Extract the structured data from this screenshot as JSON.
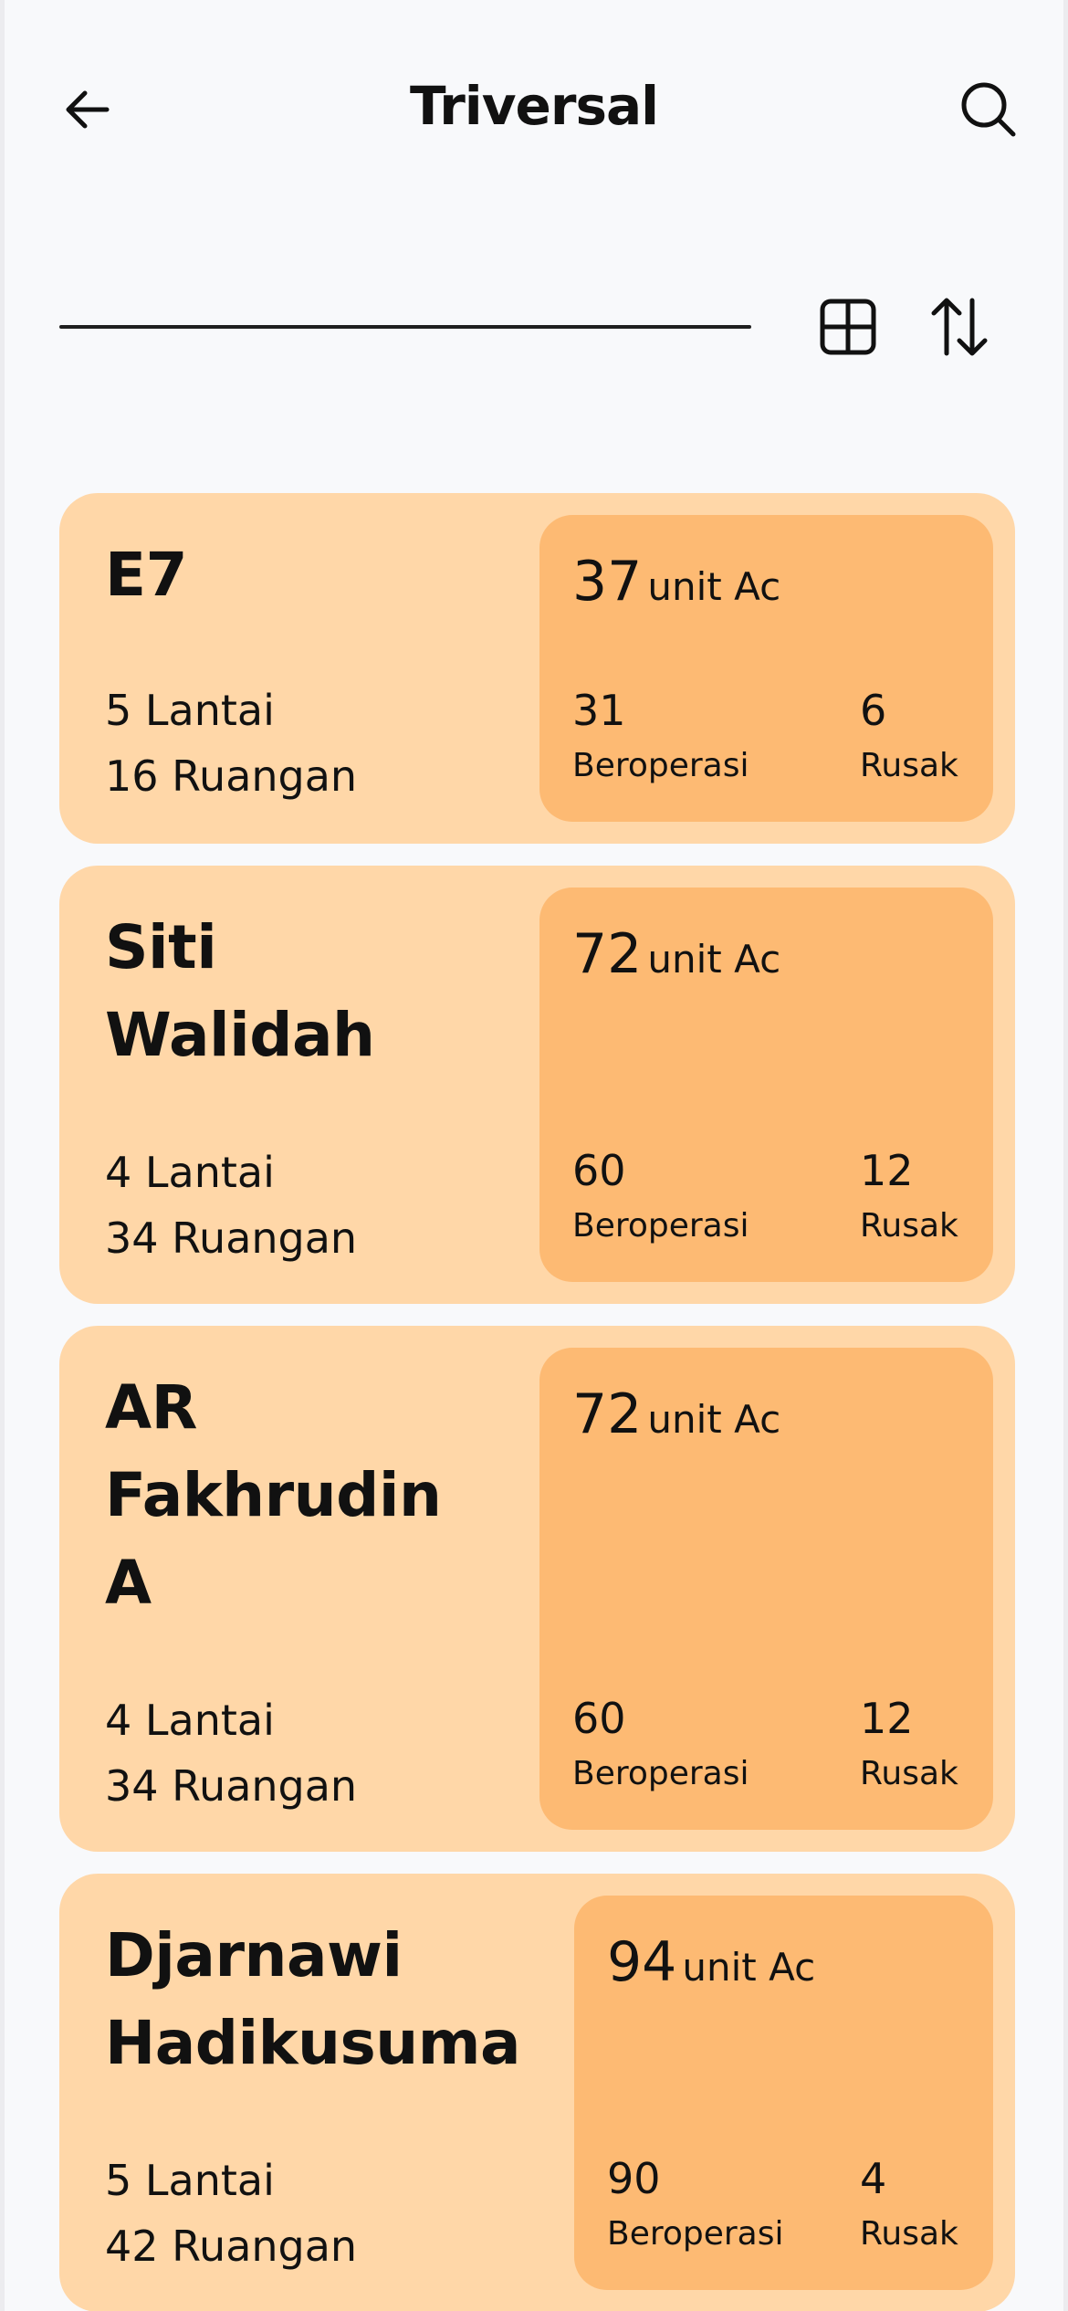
{
  "header": {
    "title": "Triversal",
    "back_icon": "arrow-left-icon",
    "search_icon": "search-icon"
  },
  "toolbar": {
    "search_value": "",
    "view_icon": "grid-view-icon",
    "sort_icon": "sort-arrows-icon"
  },
  "colors": {
    "background": "#f8f9fb",
    "card": "#ffd7a8",
    "stats_panel": "#fdba73",
    "text": "#111111"
  },
  "buildings": [
    {
      "name": "E7",
      "floors": "5 Lantai",
      "rooms": "16 Ruangan",
      "units": "37",
      "units_label": "unit Ac",
      "operating": "31",
      "operating_label": "Beroperasi",
      "broken": "6",
      "broken_label": "Rusak"
    },
    {
      "name": "Siti\nWalidah",
      "floors": "4 Lantai",
      "rooms": "34 Ruangan",
      "units": "72",
      "units_label": "unit Ac",
      "operating": "60",
      "operating_label": "Beroperasi",
      "broken": "12",
      "broken_label": "Rusak"
    },
    {
      "name": "AR\nFakhrudin\nA",
      "floors": "4 Lantai",
      "rooms": "34 Ruangan",
      "units": "72",
      "units_label": "unit Ac",
      "operating": "60",
      "operating_label": "Beroperasi",
      "broken": "12",
      "broken_label": "Rusak"
    },
    {
      "name": "Djarnawi\nHadikusuma",
      "floors": "5 Lantai",
      "rooms": "42 Ruangan",
      "units": "94",
      "units_label": "unit Ac",
      "operating": "90",
      "operating_label": "Beroperasi",
      "broken": "4",
      "broken_label": "Rusak"
    }
  ]
}
